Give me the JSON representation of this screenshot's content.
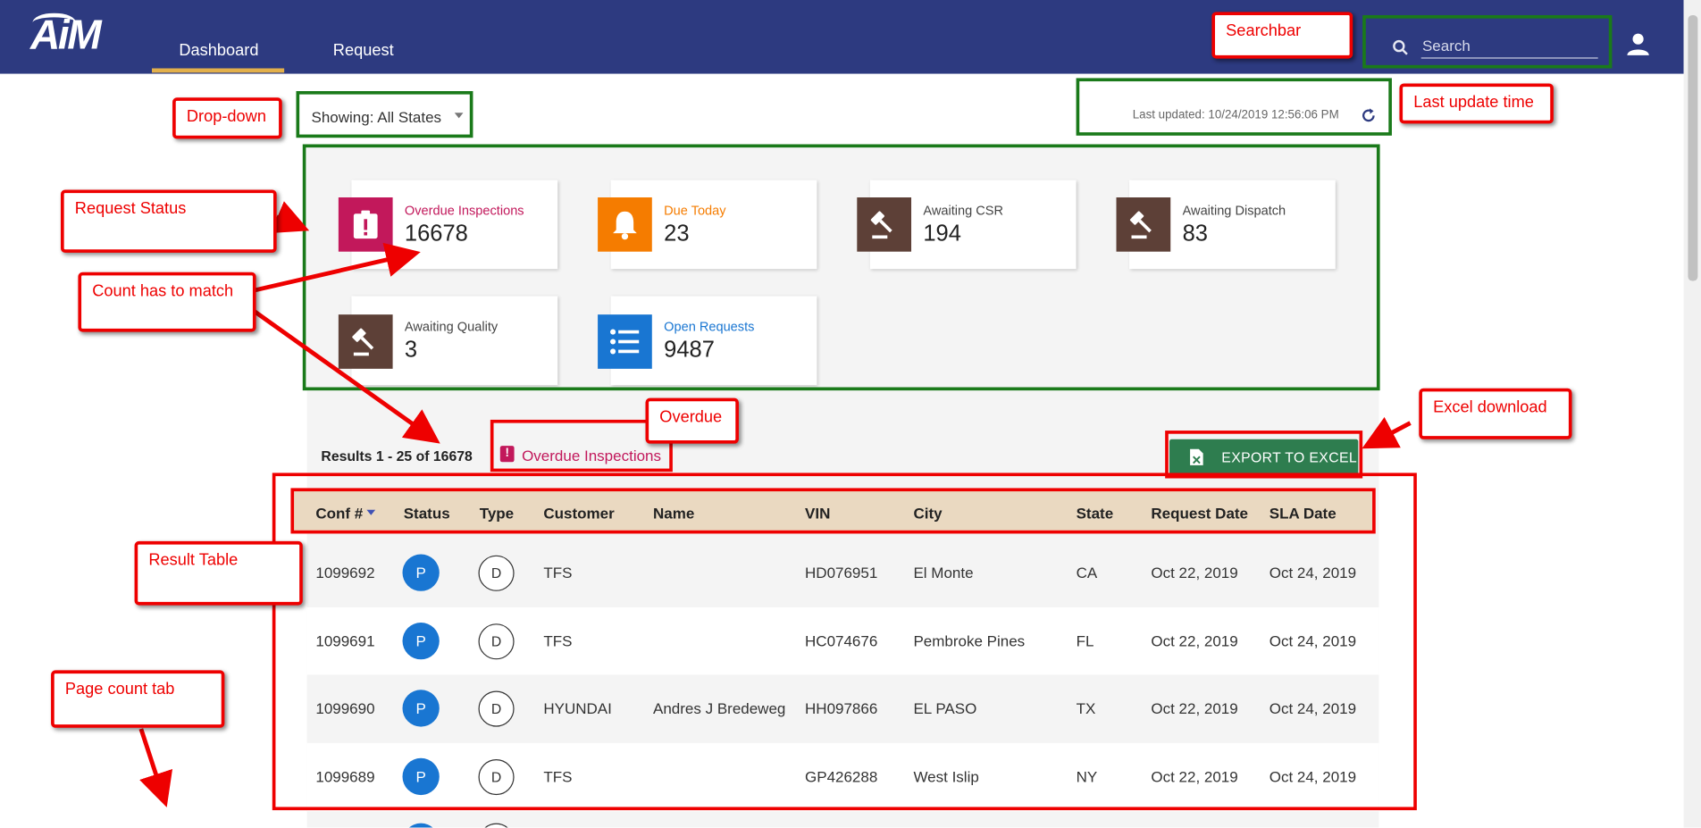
{
  "header": {
    "logo_text": "AiM",
    "tabs": [
      {
        "label": "Dashboard"
      },
      {
        "label": "Request"
      }
    ],
    "search_placeholder": "Search"
  },
  "filters": {
    "dropdown_value": "Showing: All States",
    "last_updated": "Last updated: 10/24/2019 12:56:06 PM"
  },
  "cards": [
    {
      "label": "Overdue Inspections",
      "value": "16678",
      "label_color": "#c2185b",
      "icon_bg": "#c2185b",
      "icon": "clipboard-alert-icon"
    },
    {
      "label": "Due Today",
      "value": "23",
      "label_color": "#f57c00",
      "icon_bg": "#f57c00",
      "icon": "bell-icon"
    },
    {
      "label": "Awaiting CSR",
      "value": "194",
      "label_color": "#444444",
      "icon_bg": "#5d4037",
      "icon": "gavel-icon"
    },
    {
      "label": "Awaiting Dispatch",
      "value": "83",
      "label_color": "#444444",
      "icon_bg": "#5d4037",
      "icon": "gavel-icon"
    },
    {
      "label": "Awaiting Quality",
      "value": "3",
      "label_color": "#444444",
      "icon_bg": "#5d4037",
      "icon": "gavel-icon"
    },
    {
      "label": "Open Requests",
      "value": "9487",
      "label_color": "#1976d2",
      "icon_bg": "#1976d2",
      "icon": "list-icon"
    }
  ],
  "results": {
    "summary": "Results 1 - 25 of 16678",
    "active_filter": "Overdue Inspections",
    "export_label": "EXPORT TO EXCEL"
  },
  "table": {
    "columns": [
      "Conf #",
      "Status",
      "Type",
      "Customer",
      "Name",
      "VIN",
      "City",
      "State",
      "Request Date",
      "SLA Date"
    ],
    "rows": [
      {
        "conf": "1099692",
        "status": "P",
        "type": "D",
        "customer": "TFS",
        "name": "",
        "vin": "HD076951",
        "city": "El Monte",
        "state": "CA",
        "request_date": "Oct 22, 2019",
        "sla_date": "Oct 24, 2019"
      },
      {
        "conf": "1099691",
        "status": "P",
        "type": "D",
        "customer": "TFS",
        "name": "",
        "vin": "HC074676",
        "city": "Pembroke Pines",
        "state": "FL",
        "request_date": "Oct 22, 2019",
        "sla_date": "Oct 24, 2019"
      },
      {
        "conf": "1099690",
        "status": "P",
        "type": "D",
        "customer": "HYUNDAI",
        "name": "Andres J Bredeweg",
        "vin": "HH097866",
        "city": "EL PASO",
        "state": "TX",
        "request_date": "Oct 22, 2019",
        "sla_date": "Oct 24, 2019"
      },
      {
        "conf": "1099689",
        "status": "P",
        "type": "D",
        "customer": "TFS",
        "name": "",
        "vin": "GP426288",
        "city": "West Islip",
        "state": "NY",
        "request_date": "Oct 22, 2019",
        "sla_date": "Oct 24, 2019"
      }
    ]
  },
  "annotations": {
    "searchbar": "Searchbar",
    "dropdown": "Drop-down",
    "last_update_time": "Last update time",
    "request_status": "Request Status",
    "count_has_to_match": "Count has to match",
    "overdue": "Overdue",
    "excel_download": "Excel download",
    "result_table": "Result Table",
    "page_count_tab": "Page count tab"
  },
  "colors": {
    "header_bg": "#2d3a80",
    "nav_underline": "#e3b04b",
    "annotation_red": "#ee0000",
    "annotation_green": "#1a7a1a",
    "export_green": "#2e7d4f"
  }
}
